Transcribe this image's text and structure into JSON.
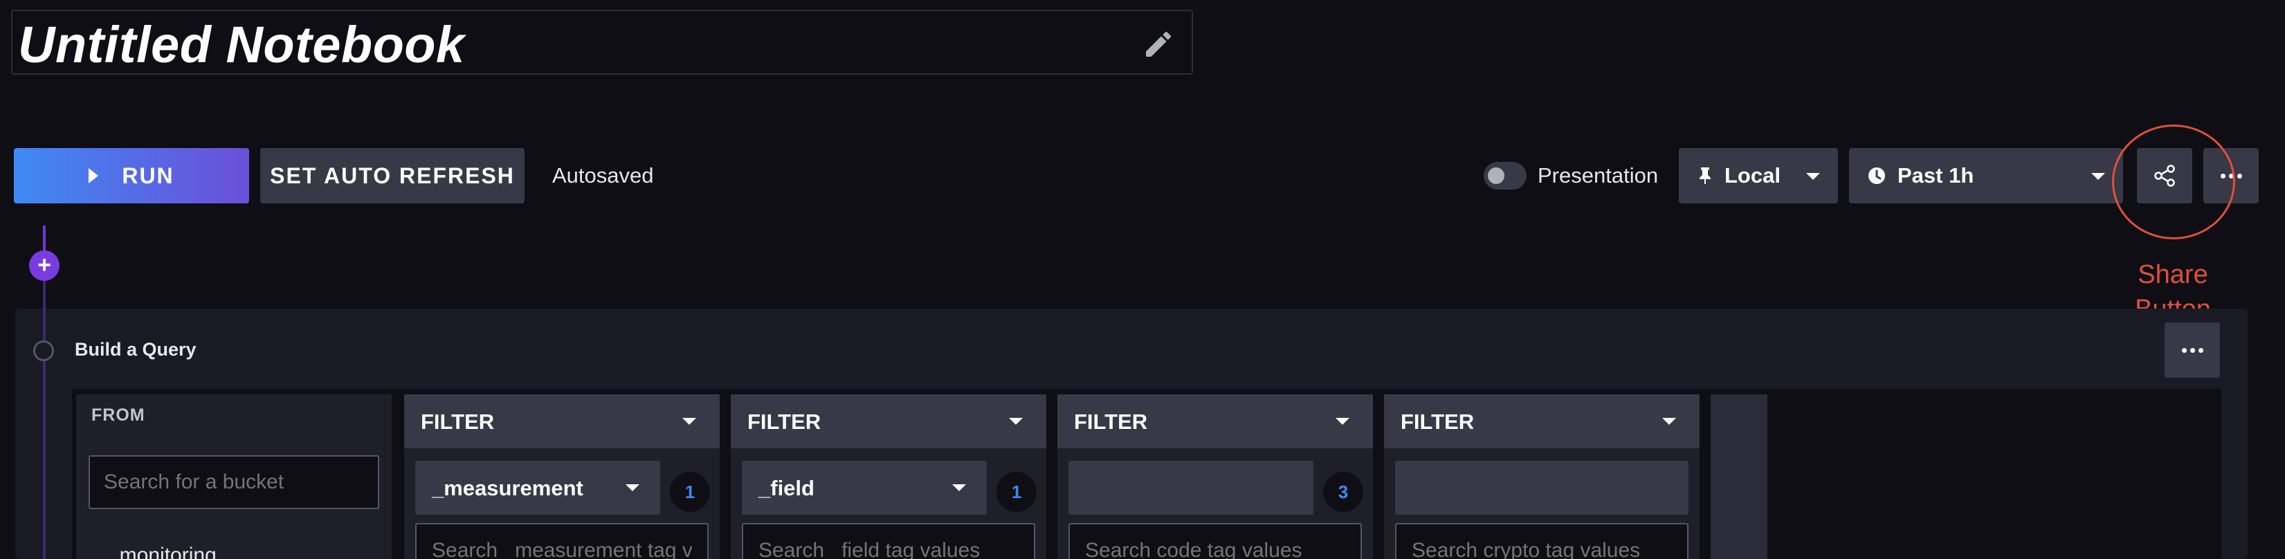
{
  "notebook": {
    "title": "Untitled Notebook"
  },
  "toolbar": {
    "run_label": "RUN",
    "refresh_label": "SET AUTO REFRESH",
    "status": "Autosaved",
    "presentation_label": "Presentation",
    "presentation_on": false,
    "local_label": "Local",
    "time_label": "Past 1h"
  },
  "annotation": {
    "text": "Share Button",
    "color": "#e0503a"
  },
  "panel": {
    "title": "Build a Query",
    "from": {
      "label": "FROM",
      "placeholder": "Search for a bucket",
      "first_bucket": "_monitoring"
    },
    "filters": [
      {
        "label": "FILTER",
        "key": "_measurement",
        "count": "1",
        "placeholder": "Search _measurement tag values",
        "closable": false
      },
      {
        "label": "FILTER",
        "key": "_field",
        "count": "1",
        "placeholder": "Search _field tag values",
        "closable": true
      },
      {
        "label": "FILTER",
        "key": "",
        "count": "3",
        "placeholder": "Search code tag values",
        "closable": true
      },
      {
        "label": "FILTER",
        "key": "",
        "count": "",
        "placeholder": "Search crypto tag values",
        "closable": true
      }
    ]
  },
  "colors": {
    "background": "#0e0e14",
    "run_gradient_start": "#3e8af4",
    "run_gradient_end": "#6b4fd8",
    "button": "#383846",
    "accent_purple": "#7a3ce0",
    "badge_text": "#3e8af4"
  }
}
